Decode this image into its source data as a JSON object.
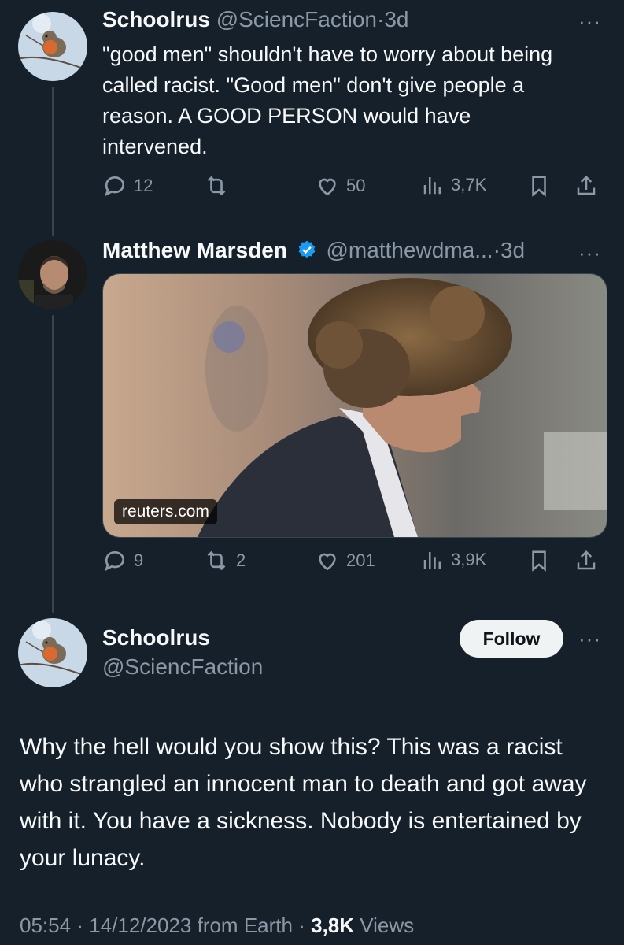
{
  "tweet1": {
    "name": "Schoolrus",
    "handle": "@SciencFaction",
    "time": "3d",
    "text": "\"good men\" shouldn't have to worry about being called racist. \"Good men\" don't give people a reason. A GOOD PERSON would have intervened.",
    "replies": "12",
    "retweets": "",
    "likes": "50",
    "views": "3,7K"
  },
  "tweet2": {
    "name": "Matthew Marsden",
    "handle": "@matthewdma...",
    "time": "3d",
    "card_source": "reuters.com",
    "replies": "9",
    "retweets": "2",
    "likes": "201",
    "views": "3,9K"
  },
  "main": {
    "name": "Schoolrus",
    "handle": "@SciencFaction",
    "follow_label": "Follow",
    "text": "Why the hell would you show this? This was a racist who strangled an innocent man to death and got away with it. You have a sickness. Nobody is entertained by your lunacy.",
    "time": "05:54",
    "date": "14/12/2023",
    "source": "from Earth",
    "views_count": "3,8K",
    "views_label": "Views"
  },
  "ui": {
    "more": "···",
    "dot": "·"
  },
  "colors": {
    "background": "#15202b",
    "text": "#f7f9f9",
    "muted": "#8b98a5",
    "verified": "#1d9bf0",
    "follow_bg": "#eff3f4"
  },
  "icons": [
    "reply-icon",
    "retweet-icon",
    "like-icon",
    "views-icon",
    "bookmark-icon",
    "share-icon",
    "verified-badge-icon",
    "more-icon"
  ]
}
